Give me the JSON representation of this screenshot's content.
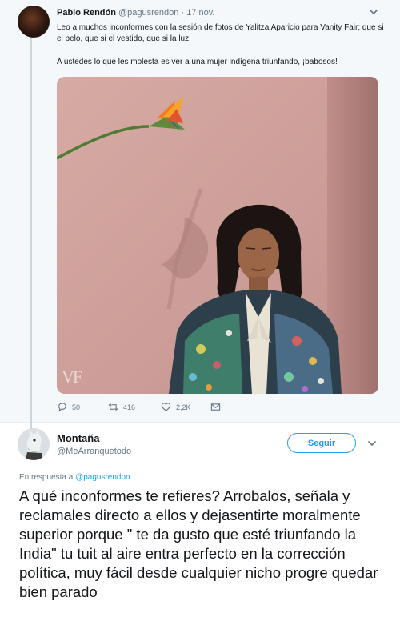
{
  "parent_tweet": {
    "name": "Pablo Rendón",
    "handle": "@pagusrendon",
    "separator": "·",
    "date": "17 nov.",
    "text_1": "Leo a muchos inconformes con la sesión de fotos de Yalitza Aparicio para Vanity Fair; que si el pelo, que si el vestido, que si la luz.",
    "text_2": "A ustedes lo que les molesta es ver a una mujer indígena triunfando, ¡babosos!",
    "photo_watermark": "VF",
    "actions": {
      "replies": "50",
      "retweets": "416",
      "likes": "2,2K"
    }
  },
  "reply_tweet": {
    "name": "Montaña",
    "handle": "@MeArranquetodo",
    "follow_label": "Seguir",
    "reply_prefix": "En respuesta a",
    "reply_mention": "@pagusrendon",
    "text": "A qué inconformes te refieres? Arrobalos, señala y reclamales directo a ellos y dejasentirte moralmente superior porque \" te da gusto que esté triunfando la India\"  tu tuit al aire entra perfecto en la corrección política, muy fácil desde cualquier nicho progre quedar bien parado"
  },
  "icons": {
    "caret": "chevron-down-icon",
    "reply": "reply-icon",
    "retweet": "retweet-icon",
    "like": "heart-icon",
    "message": "envelope-icon"
  },
  "colors": {
    "accent": "#1da1f2",
    "muted": "#657786",
    "text": "#14171a",
    "parent_bg": "#f5f8fa"
  }
}
